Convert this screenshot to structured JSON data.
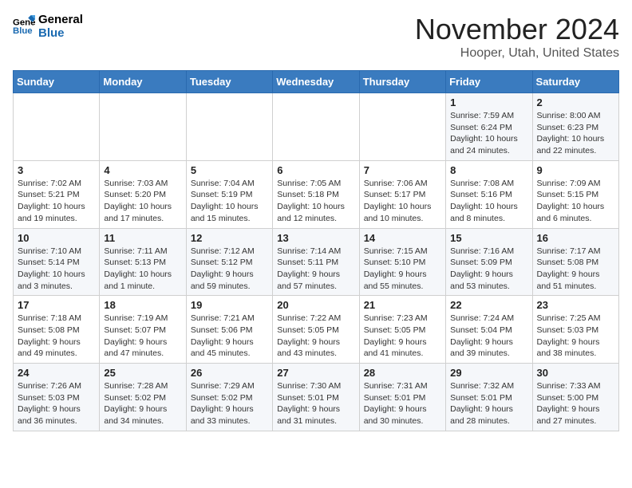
{
  "logo": {
    "line1": "General",
    "line2": "Blue"
  },
  "title": "November 2024",
  "location": "Hooper, Utah, United States",
  "days_of_week": [
    "Sunday",
    "Monday",
    "Tuesday",
    "Wednesday",
    "Thursday",
    "Friday",
    "Saturday"
  ],
  "weeks": [
    [
      {
        "day": "",
        "info": ""
      },
      {
        "day": "",
        "info": ""
      },
      {
        "day": "",
        "info": ""
      },
      {
        "day": "",
        "info": ""
      },
      {
        "day": "",
        "info": ""
      },
      {
        "day": "1",
        "info": "Sunrise: 7:59 AM\nSunset: 6:24 PM\nDaylight: 10 hours\nand 24 minutes."
      },
      {
        "day": "2",
        "info": "Sunrise: 8:00 AM\nSunset: 6:23 PM\nDaylight: 10 hours\nand 22 minutes."
      }
    ],
    [
      {
        "day": "3",
        "info": "Sunrise: 7:02 AM\nSunset: 5:21 PM\nDaylight: 10 hours\nand 19 minutes."
      },
      {
        "day": "4",
        "info": "Sunrise: 7:03 AM\nSunset: 5:20 PM\nDaylight: 10 hours\nand 17 minutes."
      },
      {
        "day": "5",
        "info": "Sunrise: 7:04 AM\nSunset: 5:19 PM\nDaylight: 10 hours\nand 15 minutes."
      },
      {
        "day": "6",
        "info": "Sunrise: 7:05 AM\nSunset: 5:18 PM\nDaylight: 10 hours\nand 12 minutes."
      },
      {
        "day": "7",
        "info": "Sunrise: 7:06 AM\nSunset: 5:17 PM\nDaylight: 10 hours\nand 10 minutes."
      },
      {
        "day": "8",
        "info": "Sunrise: 7:08 AM\nSunset: 5:16 PM\nDaylight: 10 hours\nand 8 minutes."
      },
      {
        "day": "9",
        "info": "Sunrise: 7:09 AM\nSunset: 5:15 PM\nDaylight: 10 hours\nand 6 minutes."
      }
    ],
    [
      {
        "day": "10",
        "info": "Sunrise: 7:10 AM\nSunset: 5:14 PM\nDaylight: 10 hours\nand 3 minutes."
      },
      {
        "day": "11",
        "info": "Sunrise: 7:11 AM\nSunset: 5:13 PM\nDaylight: 10 hours\nand 1 minute."
      },
      {
        "day": "12",
        "info": "Sunrise: 7:12 AM\nSunset: 5:12 PM\nDaylight: 9 hours\nand 59 minutes."
      },
      {
        "day": "13",
        "info": "Sunrise: 7:14 AM\nSunset: 5:11 PM\nDaylight: 9 hours\nand 57 minutes."
      },
      {
        "day": "14",
        "info": "Sunrise: 7:15 AM\nSunset: 5:10 PM\nDaylight: 9 hours\nand 55 minutes."
      },
      {
        "day": "15",
        "info": "Sunrise: 7:16 AM\nSunset: 5:09 PM\nDaylight: 9 hours\nand 53 minutes."
      },
      {
        "day": "16",
        "info": "Sunrise: 7:17 AM\nSunset: 5:08 PM\nDaylight: 9 hours\nand 51 minutes."
      }
    ],
    [
      {
        "day": "17",
        "info": "Sunrise: 7:18 AM\nSunset: 5:08 PM\nDaylight: 9 hours\nand 49 minutes."
      },
      {
        "day": "18",
        "info": "Sunrise: 7:19 AM\nSunset: 5:07 PM\nDaylight: 9 hours\nand 47 minutes."
      },
      {
        "day": "19",
        "info": "Sunrise: 7:21 AM\nSunset: 5:06 PM\nDaylight: 9 hours\nand 45 minutes."
      },
      {
        "day": "20",
        "info": "Sunrise: 7:22 AM\nSunset: 5:05 PM\nDaylight: 9 hours\nand 43 minutes."
      },
      {
        "day": "21",
        "info": "Sunrise: 7:23 AM\nSunset: 5:05 PM\nDaylight: 9 hours\nand 41 minutes."
      },
      {
        "day": "22",
        "info": "Sunrise: 7:24 AM\nSunset: 5:04 PM\nDaylight: 9 hours\nand 39 minutes."
      },
      {
        "day": "23",
        "info": "Sunrise: 7:25 AM\nSunset: 5:03 PM\nDaylight: 9 hours\nand 38 minutes."
      }
    ],
    [
      {
        "day": "24",
        "info": "Sunrise: 7:26 AM\nSunset: 5:03 PM\nDaylight: 9 hours\nand 36 minutes."
      },
      {
        "day": "25",
        "info": "Sunrise: 7:28 AM\nSunset: 5:02 PM\nDaylight: 9 hours\nand 34 minutes."
      },
      {
        "day": "26",
        "info": "Sunrise: 7:29 AM\nSunset: 5:02 PM\nDaylight: 9 hours\nand 33 minutes."
      },
      {
        "day": "27",
        "info": "Sunrise: 7:30 AM\nSunset: 5:01 PM\nDaylight: 9 hours\nand 31 minutes."
      },
      {
        "day": "28",
        "info": "Sunrise: 7:31 AM\nSunset: 5:01 PM\nDaylight: 9 hours\nand 30 minutes."
      },
      {
        "day": "29",
        "info": "Sunrise: 7:32 AM\nSunset: 5:01 PM\nDaylight: 9 hours\nand 28 minutes."
      },
      {
        "day": "30",
        "info": "Sunrise: 7:33 AM\nSunset: 5:00 PM\nDaylight: 9 hours\nand 27 minutes."
      }
    ]
  ]
}
